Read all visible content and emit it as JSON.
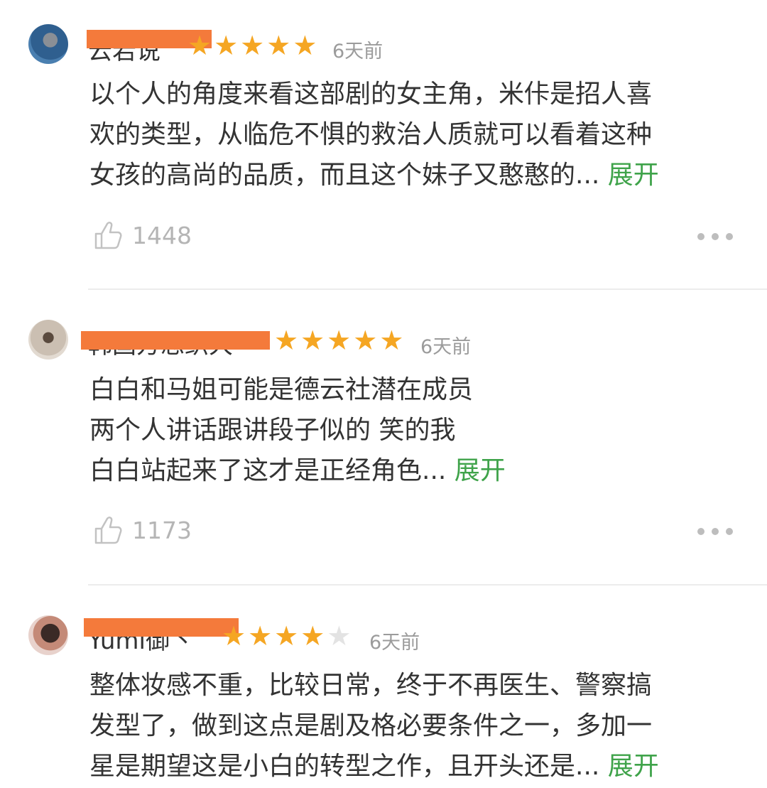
{
  "comments": [
    {
      "username": "云若说",
      "stars": 5,
      "date": "6天前",
      "lines": [
        "以个人的角度来看这部剧的女主角，米佧是招人喜",
        "欢的类型，从临危不惧的救治人质就可以看着这种",
        "女孩的高尚的品质，而且这个妹子又憨憨的..."
      ],
      "expand": "展开",
      "likes": "1448"
    },
    {
      "username": "韩国方思织大",
      "stars": 5,
      "date": "6天前",
      "lines": [
        "白白和马姐可能是德云社潜在成员",
        "两个人讲话跟讲段子似的 笑的我",
        "白白站起来了这才是正经角色..."
      ],
      "expand": "展开",
      "likes": "1173"
    },
    {
      "username": "Yumi御丶",
      "stars": 4,
      "date": "6天前",
      "lines": [
        "整体妆感不重，比较日常，终于不再医生、警察搞",
        "发型了，做到这点是剧及格必要条件之一，多加一",
        "星是期望这是小白的转型之作，且开头还是..."
      ],
      "expand": "展开",
      "likes": ""
    }
  ],
  "colors": {
    "star_on": "#f5a623",
    "star_off": "#e3e3e3",
    "expand": "#3fa34a",
    "redaction": "#f47a3b"
  },
  "icons": {
    "like": "thumbs-up-icon",
    "more": "more-dots-icon"
  }
}
